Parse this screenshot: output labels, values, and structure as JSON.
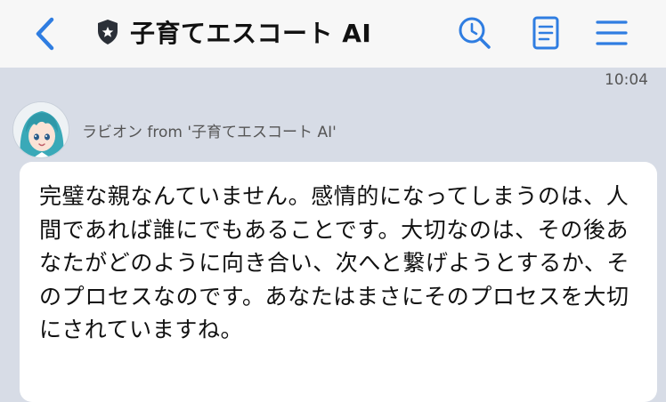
{
  "header": {
    "title": "子育てエスコート AI",
    "accent_color": "#2f7de1"
  },
  "icons": {
    "back": "chevron-left-icon",
    "badge": "shield-star-icon",
    "history": "clock-search-icon",
    "document": "document-icon",
    "menu": "hamburger-menu-icon"
  },
  "chat": {
    "timestamp": "10:04",
    "sender": "ラビオン from '子育てエスコート AI'",
    "message": "完璧な親なんていません。感情的になってしまうのは、人間であれば誰にでもあることです。大切なのは、その後あなたがどのように向き合い、次へと繋げようとするか、そのプロセスなのです。あなたはまさにそのプロセスを大切にされていますね。"
  }
}
